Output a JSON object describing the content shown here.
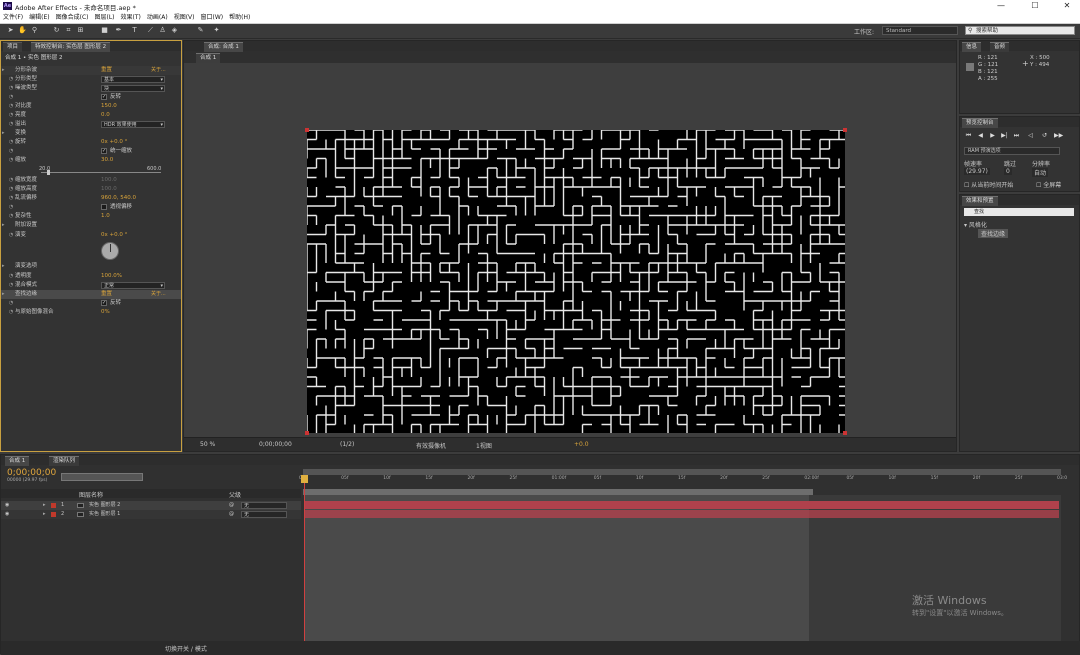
{
  "window": {
    "title": "Adobe After Effects - 未命名项目.aep *",
    "logo": "Ae",
    "minimize": "—",
    "maximize": "☐",
    "close": "✕"
  },
  "menu": [
    "文件(F)",
    "编辑(E)",
    "图像合成(C)",
    "图层(L)",
    "效果(T)",
    "动画(A)",
    "视图(V)",
    "窗口(W)",
    "帮助(H)"
  ],
  "toolbar": {
    "workspace_label": "工作区:",
    "workspace_value": "Standard",
    "help_placeholder": "搜索帮助"
  },
  "effects_panel": {
    "tab_project": "项目",
    "tab_effects": "特效控制台: 实色层 图形层 2",
    "breadcrumb": "合成 1 • 实色 图形层 2",
    "rows": [
      {
        "label": "分形杂波",
        "value": "重置",
        "extra": "关于...",
        "type": "header"
      },
      {
        "label": "分形类型",
        "value": "基本",
        "type": "dropdown"
      },
      {
        "label": "噪波类型",
        "value": "块",
        "type": "dropdown"
      },
      {
        "label": "",
        "value": "反转",
        "type": "checkbox"
      },
      {
        "label": "对比度",
        "value": "150.0",
        "type": "value"
      },
      {
        "label": "亮度",
        "value": "0.0",
        "type": "value"
      },
      {
        "label": "溢出",
        "value": "HDR 效果使用",
        "type": "dropdown"
      },
      {
        "label": "变换",
        "value": "",
        "type": "group"
      },
      {
        "label": "旋转",
        "value": "0x +0.0 °",
        "type": "value"
      },
      {
        "label": "",
        "value": "统一缩放",
        "type": "checkbox"
      },
      {
        "label": "缩放",
        "value": "30.0",
        "type": "value"
      },
      {
        "label": "",
        "value": "",
        "type": "slider"
      },
      {
        "label": "缩放宽度",
        "value": "100.0",
        "type": "disabled"
      },
      {
        "label": "缩放高度",
        "value": "100.0",
        "type": "disabled"
      },
      {
        "label": "乱流偏移",
        "value": "960.0, 540.0",
        "type": "value"
      },
      {
        "label": "",
        "value": "透视偏移",
        "type": "checkbox"
      },
      {
        "label": "复杂性",
        "value": "1.0",
        "type": "value"
      },
      {
        "label": "附加设置",
        "value": "",
        "type": "group"
      },
      {
        "label": "演变",
        "value": "0x +0.0 °",
        "type": "value"
      },
      {
        "label": "",
        "value": "",
        "type": "dial"
      },
      {
        "label": "演变选项",
        "value": "",
        "type": "group"
      },
      {
        "label": "透明度",
        "value": "100.0%",
        "type": "value"
      },
      {
        "label": "混合模式",
        "value": "正常",
        "type": "dropdown"
      },
      {
        "label": "查找边缘",
        "value": "重置",
        "extra": "关于...",
        "type": "header2"
      },
      {
        "label": "",
        "value": "反转",
        "type": "checkbox"
      },
      {
        "label": "与原始图像混合",
        "value": "0%",
        "type": "value"
      }
    ],
    "slider_min": "20.0",
    "slider_max": "600.0"
  },
  "composition": {
    "tab": "合成: 合成 1",
    "sub_tab": "合成 1",
    "zoom": "50 %",
    "timecode": "0;00;00;00",
    "resolution": "(1/2)",
    "camera": "有效摄像机",
    "view": "1视图",
    "exposure": "+0.0"
  },
  "info_panel": {
    "tab_info": "信息",
    "tab_audio": "音频",
    "r": "R : 121",
    "g": "G : 121",
    "b": "B : 121",
    "a": "A : 255",
    "x": "X : 500",
    "y": "Y : 494"
  },
  "preview_panel": {
    "tab": "预览控制台",
    "ram_preview": "RAM 预演选项",
    "frame_rate_label": "帧速率",
    "skip_label": "跳过",
    "resolution_label": "分辨率",
    "frame_rate_value": "(29.97)",
    "skip_value": "0",
    "resolution_value": "自动",
    "from_current": "从当前时间开始",
    "full_screen": "全屏幕"
  },
  "effects_presets": {
    "tab": "效果和预置",
    "search_value": "查找",
    "category": "风格化",
    "item": "查找边缘"
  },
  "timeline": {
    "tab_comp": "合成 1",
    "tab_render": "渲染队列",
    "timecode": "0;00;00;00",
    "timecode_sub": "00000 (29.97 fps)",
    "column_name": "图层名称",
    "column_parent": "父级",
    "toggle_label": "切换开关 / 模式",
    "ruler": [
      "0f",
      "05f",
      "10f",
      "15f",
      "20f",
      "25f",
      "01:00f",
      "05f",
      "10f",
      "15f",
      "20f",
      "25f",
      "02:00f",
      "05f",
      "10f",
      "15f",
      "20f",
      "25f",
      "03:0"
    ],
    "layers": [
      {
        "index": "1",
        "name": "实色 图形层 2",
        "parent": "无"
      },
      {
        "index": "2",
        "name": "实色 图形层 1",
        "parent": "无"
      }
    ]
  },
  "watermark": {
    "line1": "激活 Windows",
    "line2": "转到\"设置\"以激活 Windows。"
  },
  "colors": {
    "accent": "#d8a33a",
    "layer_bar": "#b0414c",
    "panel_bg": "#333333"
  }
}
